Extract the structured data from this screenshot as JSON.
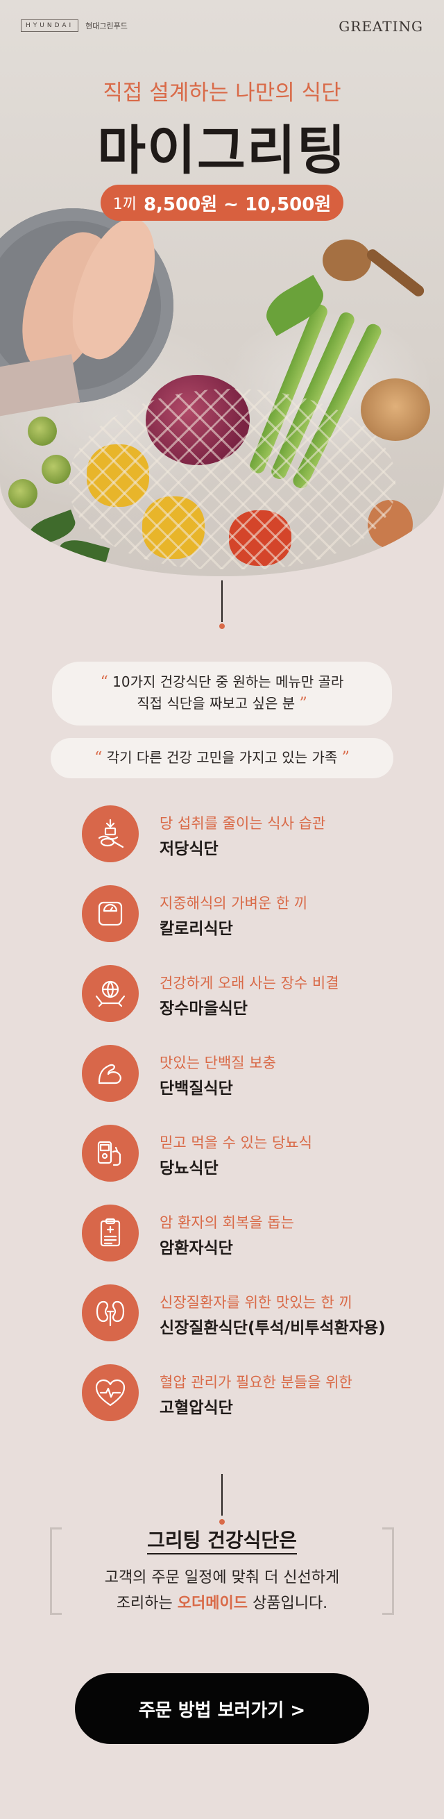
{
  "header": {
    "brand_box": "HYUNDAI",
    "brand_sub": "현대그린푸드",
    "brand_right": "GREATING"
  },
  "hero": {
    "subtitle": "직접 설계하는 나만의 식단",
    "title": "마이그리팅",
    "price_prefix": "1끼",
    "price_range": "8,500원 ~ 10,500원"
  },
  "quotes": [
    {
      "open": "“",
      "line1": "10가지 건강식단 중 원하는 메뉴만 골라",
      "line2": "직접 식단을 짜보고 싶은 분",
      "close": "”"
    },
    {
      "open": "“",
      "line1": "각기 다른 건강 고민을 가지고 있는 가족",
      "close": "”"
    }
  ],
  "diets": [
    {
      "desc": "당 섭취를 줄이는 식사 습관",
      "name": "저당식단",
      "icon": "spoon-sugar-icon"
    },
    {
      "desc": "지중해식의 가벼운 한 끼",
      "name": "칼로리식단",
      "icon": "scale-icon"
    },
    {
      "desc": "건강하게 오래 사는 장수 비결",
      "name": "장수마을식단",
      "icon": "globe-hands-icon"
    },
    {
      "desc": "맛있는 단백질 보충",
      "name": "단백질식단",
      "icon": "muscle-arm-icon"
    },
    {
      "desc": "믿고 먹을 수 있는 당뇨식",
      "name": "당뇨식단",
      "icon": "glucose-meter-icon"
    },
    {
      "desc": "암 환자의 회복을 돕는",
      "name": "암환자식단",
      "icon": "clipboard-icon"
    },
    {
      "desc": "신장질환자를 위한 맛있는 한 끼",
      "name": "신장질환식단(투석/비투석환자용)",
      "icon": "kidney-icon"
    },
    {
      "desc": "혈압 관리가 필요한 분들을 위한",
      "name": "고혈압식단",
      "icon": "heart-pulse-icon"
    }
  ],
  "summary": {
    "title": "그리팅 건강식단은",
    "line1": "고객의 주문 일정에 맞춰 더 신선하게",
    "line2_pre": "조리하는 ",
    "line2_hl": "오더메이드",
    "line2_post": " 상품입니다."
  },
  "cta": {
    "label": "주문 방법 보러가기 >"
  },
  "colors": {
    "accent": "#d8674a",
    "background": "#e8dedb",
    "cta": "#050505"
  }
}
